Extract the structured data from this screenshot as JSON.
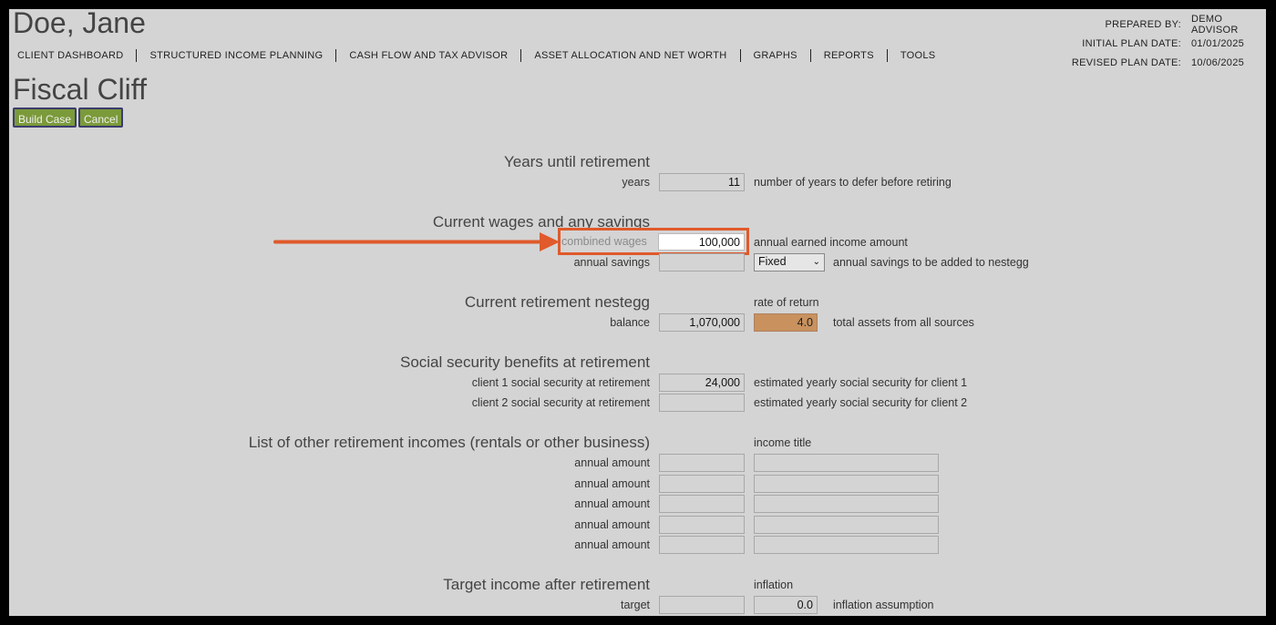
{
  "client_name": "Doe, Jane",
  "meta": {
    "prepared_by_label": "PREPARED BY:",
    "prepared_by": "DEMO ADVISOR",
    "initial_label": "INITIAL PLAN DATE:",
    "initial_date": "01/01/2025",
    "revised_label": "REVISED PLAN DATE:",
    "revised_date": "10/06/2025"
  },
  "nav": [
    "CLIENT DASHBOARD",
    "STRUCTURED INCOME PLANNING",
    "CASH FLOW AND TAX ADVISOR",
    "ASSET ALLOCATION AND NET WORTH",
    "GRAPHS",
    "REPORTS",
    "TOOLS"
  ],
  "page_title": "Fiscal Cliff",
  "buttons": {
    "build_case": "Build Case",
    "cancel": "Cancel"
  },
  "retirement": {
    "title": "Years until retirement",
    "years_label": "years",
    "years_value": "11",
    "years_hint": "number of years to defer before retiring"
  },
  "wages": {
    "title": "Current wages and any savings",
    "combined_label": "combined wages",
    "combined_value": "100,000",
    "combined_hint": "annual earned income amount",
    "savings_label": "annual savings",
    "savings_value": "",
    "savings_type": "Fixed",
    "savings_hint": "annual savings to be added to nestegg"
  },
  "nestegg": {
    "title": "Current retirement nestegg",
    "rate_header": "rate of return",
    "balance_label": "balance",
    "balance_value": "1,070,000",
    "rate_value": "4.0",
    "hint": "total assets from all sources"
  },
  "social": {
    "title": "Social security benefits at retirement",
    "c1_label": "client 1 social security at retirement",
    "c1_value": "24,000",
    "c1_hint": "estimated yearly social security for client 1",
    "c2_label": "client 2 social security at retirement",
    "c2_value": "",
    "c2_hint": "estimated yearly social security for client 2"
  },
  "other": {
    "title": "List of other retirement incomes (rentals or other business)",
    "income_header": "income title",
    "rows": [
      {
        "label": "annual amount",
        "amount": "",
        "title": ""
      },
      {
        "label": "annual amount",
        "amount": "",
        "title": ""
      },
      {
        "label": "annual amount",
        "amount": "",
        "title": ""
      },
      {
        "label": "annual amount",
        "amount": "",
        "title": ""
      },
      {
        "label": "annual amount",
        "amount": "",
        "title": ""
      }
    ]
  },
  "target": {
    "title": "Target income after retirement",
    "inflation_header": "inflation",
    "target_label": "target",
    "target_value": "",
    "inflation_value": "0.0",
    "inflation_hint": "inflation assumption"
  },
  "colors": {
    "highlight": "#e05a2b",
    "button": "#7b9a3a",
    "rate_field": "#c8915e"
  }
}
